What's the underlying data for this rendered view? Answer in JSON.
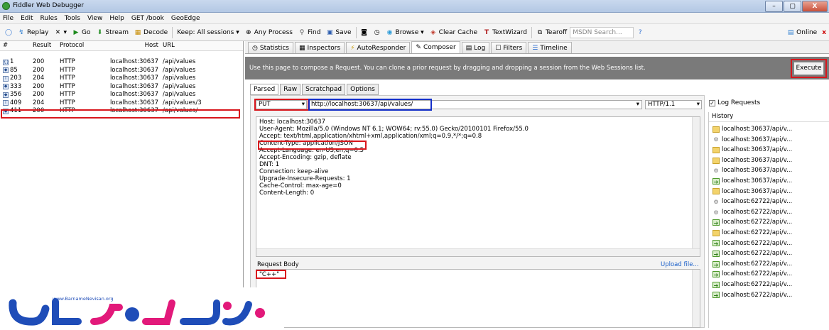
{
  "window": {
    "title": "Fiddler Web Debugger",
    "minimize": "–",
    "maximize": "▢",
    "close": "X"
  },
  "menu": [
    "File",
    "Edit",
    "Rules",
    "Tools",
    "View",
    "Help",
    "GET /book",
    "GeoEdge"
  ],
  "toolbar": {
    "replay": "Replay",
    "remove": "▾",
    "go": "Go",
    "stream": "Stream",
    "decode": "Decode",
    "keep": "Keep: All sessions ▾",
    "any_process": "Any Process",
    "find": "Find",
    "save": "Save",
    "browse": "Browse ▾",
    "clear_cache": "Clear Cache",
    "textwizard": "TextWizard",
    "tearoff": "Tearoff",
    "msdn_placeholder": "MSDN Search...",
    "online": "Online"
  },
  "sessions": {
    "columns": [
      "#",
      "Result",
      "Protocol",
      "Host",
      "URL"
    ],
    "rows": [
      {
        "id": "1",
        "result": "200",
        "protocol": "HTTP",
        "host": "localhost:30637",
        "url": "/api/values",
        "icon": "{}"
      },
      {
        "id": "85",
        "result": "200",
        "protocol": "HTTP",
        "host": "localhost:30637",
        "url": "/api/values",
        "icon": "◆"
      },
      {
        "id": "203",
        "result": "204",
        "protocol": "HTTP",
        "host": "localhost:30637",
        "url": "/api/values",
        "icon": "i"
      },
      {
        "id": "333",
        "result": "200",
        "protocol": "HTTP",
        "host": "localhost:30637",
        "url": "/api/values",
        "icon": "◆"
      },
      {
        "id": "356",
        "result": "200",
        "protocol": "HTTP",
        "host": "localhost:30637",
        "url": "/api/values",
        "icon": "◆"
      },
      {
        "id": "409",
        "result": "204",
        "protocol": "HTTP",
        "host": "localhost:30637",
        "url": "/api/values/3",
        "icon": "i"
      },
      {
        "id": "411",
        "result": "200",
        "protocol": "HTTP",
        "host": "localhost:30637",
        "url": "/api/values/",
        "icon": "◆"
      }
    ]
  },
  "tabs": [
    "Statistics",
    "Inspectors",
    "AutoResponder",
    "Composer",
    "Log",
    "Filters",
    "Timeline"
  ],
  "composer": {
    "banner": "Use this page to compose a Request. You can clone a prior request by dragging and dropping a session from the Web Sessions list.",
    "execute": "Execute",
    "subtabs": [
      "Parsed",
      "Raw",
      "Scratchpad",
      "Options"
    ],
    "method": "PUT",
    "url": "http://localhost:30637/api/values/",
    "http_version": "HTTP/1.1",
    "headers": [
      "Host: localhost:30637",
      "User-Agent: Mozilla/5.0 (Windows NT 6.1; WOW64; rv:55.0) Gecko/20100101 Firefox/55.0",
      "Accept: text/html,application/xhtml+xml,application/xml;q=0.9,*/*;q=0.8",
      "Content-Type: application/JSON",
      "Accept-Language: en-US,en;q=0.5",
      "Accept-Encoding: gzip, deflate",
      "DNT: 1",
      "Connection: keep-alive",
      "Upgrade-Insecure-Requests: 1",
      "Cache-Control: max-age=0",
      "Content-Length: 0"
    ],
    "request_body_label": "Request Body",
    "upload_file": "Upload file...",
    "body": "\"C++\""
  },
  "history": {
    "log_requests": "Log Requests",
    "header": "History",
    "items": [
      {
        "text": "localhost:30637/api/v...",
        "kind": "doc"
      },
      {
        "text": "localhost:30637/api/v...",
        "kind": "gear"
      },
      {
        "text": "localhost:30637/api/v...",
        "kind": "doc"
      },
      {
        "text": "localhost:30637/api/v...",
        "kind": "doc"
      },
      {
        "text": "localhost:30637/api/v...",
        "kind": "gear"
      },
      {
        "text": "localhost:30637/api/v...",
        "kind": "arrow"
      },
      {
        "text": "localhost:30637/api/v...",
        "kind": "doc"
      },
      {
        "text": "localhost:62722/api/v...",
        "kind": "gear"
      },
      {
        "text": "localhost:62722/api/v...",
        "kind": "gear"
      },
      {
        "text": "localhost:62722/api/v...",
        "kind": "arrow"
      },
      {
        "text": "localhost:62722/api/v...",
        "kind": "doc"
      },
      {
        "text": "localhost:62722/api/v...",
        "kind": "arrow"
      },
      {
        "text": "localhost:62722/api/v...",
        "kind": "arrow"
      },
      {
        "text": "localhost:62722/api/v...",
        "kind": "arrow"
      },
      {
        "text": "localhost:62722/api/v...",
        "kind": "arrow"
      },
      {
        "text": "localhost:62722/api/v...",
        "kind": "arrow"
      },
      {
        "text": "localhost:62722/api/v...",
        "kind": "arrow"
      }
    ]
  },
  "watermark": {
    "site": "www.BarnameNevisan.org"
  },
  "colors": {
    "highlight_red": "#d8161c",
    "highlight_blue": "#1530c8",
    "banner_gray": "#7a7a7a"
  }
}
